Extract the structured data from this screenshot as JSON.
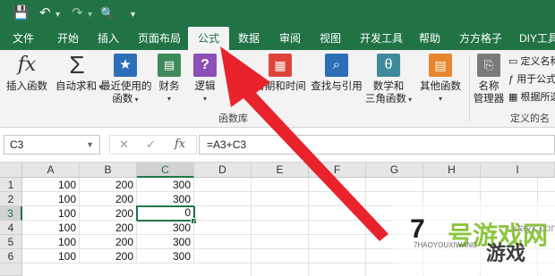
{
  "qat": {
    "save": "💾",
    "undo": "↶",
    "redo": "↷",
    "print": "🔍",
    "more": "▾"
  },
  "tabs": [
    "文件",
    "开始",
    "插入",
    "页面布局",
    "公式",
    "数据",
    "审阅",
    "视图",
    "开发工具",
    "帮助",
    "方方格子",
    "DIY工具"
  ],
  "active_tab": "公式",
  "ribbon": {
    "insert_function": "插入函数",
    "autosum": "自动求和",
    "recent_line1": "最近使用的",
    "recent_line2": "函数",
    "financial": "财务",
    "logical": "逻辑",
    "datetime": "日期和时间",
    "lookup": "查找与引用",
    "math_line1": "数学和",
    "math_line2": "三角函数",
    "more_functions": "其他函数",
    "group_label": "函数库",
    "name_manager_line1": "名称",
    "name_manager_line2": "管理器",
    "define_name": "定义名称",
    "use_in_formula": "用于公式",
    "create_from_selection": "根据所选",
    "defined_names_label": "定义的名称"
  },
  "formula_bar": {
    "name_box": "C3",
    "cancel": "✕",
    "enter": "✓",
    "fx": "fx",
    "formula": "=A3+C3"
  },
  "columns": [
    "A",
    "B",
    "C",
    "D",
    "E",
    "F",
    "G",
    "H",
    "I"
  ],
  "selected_column": "C",
  "rows": [
    {
      "num": "1",
      "a": "100",
      "b": "200",
      "c": "300"
    },
    {
      "num": "2",
      "a": "100",
      "b": "200",
      "c": "300"
    },
    {
      "num": "3",
      "a": "100",
      "b": "200",
      "c": "0"
    },
    {
      "num": "4",
      "a": "100",
      "b": "200",
      "c": "300"
    },
    {
      "num": "5",
      "a": "100",
      "b": "200",
      "c": "300"
    },
    {
      "num": "6",
      "a": "100",
      "b": "200",
      "c": "300"
    }
  ],
  "active_cell": "C3",
  "watermark": {
    "num": "7",
    "text": "号游戏网",
    "sub_text": "游戏",
    "url": "7HAOYOUXIWANG",
    "com": "xiayx.com"
  },
  "colors": {
    "excel_green": "#217346",
    "arrow_red": "#e8232b"
  }
}
